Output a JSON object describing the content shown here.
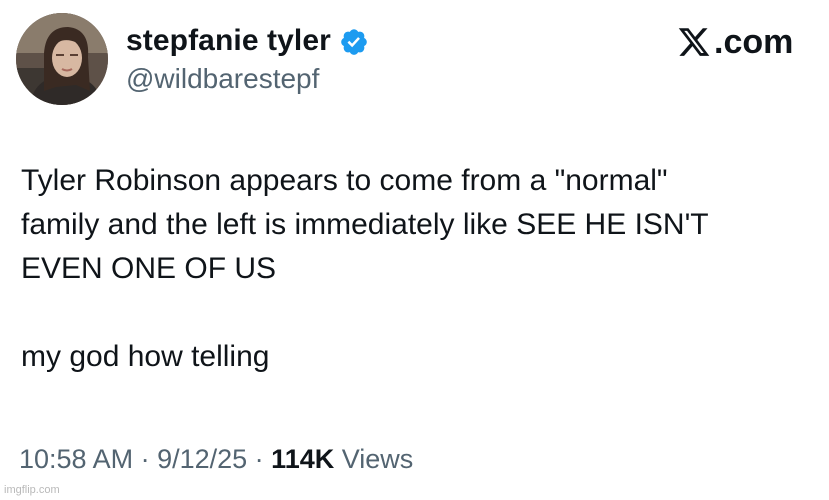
{
  "author": {
    "display_name": "stepfanie tyler",
    "handle": "@wildbarestepf",
    "avatar_icon": "profile-photo",
    "verified_icon": "verified-badge-icon",
    "verified_color": "#1d9bf0"
  },
  "brand": {
    "label": ".com",
    "icon": "x-logo-icon"
  },
  "tweet": {
    "lines": [
      "Tyler Robinson appears to come from a \"normal\"",
      "family and the left is immediately like SEE HE ISN'T",
      "EVEN ONE OF US"
    ],
    "closing": "my god how telling"
  },
  "meta": {
    "time": "10:58 AM",
    "separator": " · ",
    "date": "9/12/25",
    "views_count": "114K",
    "views_label": " Views"
  },
  "watermark": "imgflip.com",
  "colors": {
    "text": "#0f1419",
    "secondary": "#536471",
    "background": "#ffffff"
  }
}
